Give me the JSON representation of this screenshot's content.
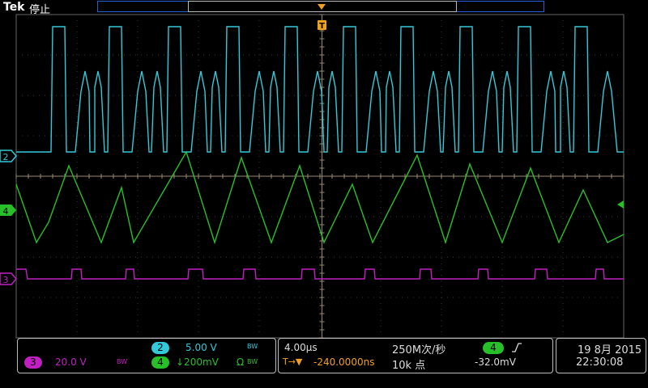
{
  "header": {
    "brand": "Tek",
    "state": "停止"
  },
  "trigger_marker": {
    "label": "T"
  },
  "channels": [
    {
      "id": "2",
      "color": "#33c9d9"
    },
    {
      "id": "4",
      "color": "#28c028"
    },
    {
      "id": "3",
      "color": "#c020c0"
    }
  ],
  "ch2_panel": {
    "num": "2",
    "scale": "5.00 V",
    "bw": "BW"
  },
  "ch3_panel": {
    "num": "3",
    "scale": "20.0 V",
    "bw": "BW"
  },
  "ch4_panel": {
    "num": "4",
    "scale": "↓200mV",
    "coupling": "Ω",
    "bw": "BW"
  },
  "timebase": {
    "scale": "4.00µs",
    "sample_rate": "250M次/秒",
    "delay_icon": "T→▼",
    "delay": "-240.0000ns",
    "record": "10k 点"
  },
  "trigger": {
    "source": "4",
    "slope_icon": "rising-edge-icon",
    "level": "-32.0mV"
  },
  "datetime": {
    "date": "19 8月 2015",
    "time": "22:30:08"
  },
  "colors": {
    "ch2": "#33c9d9",
    "ch4": "#28c028",
    "ch3": "#c020c0",
    "trigger": "#f0a020",
    "grid": "#444444"
  }
}
